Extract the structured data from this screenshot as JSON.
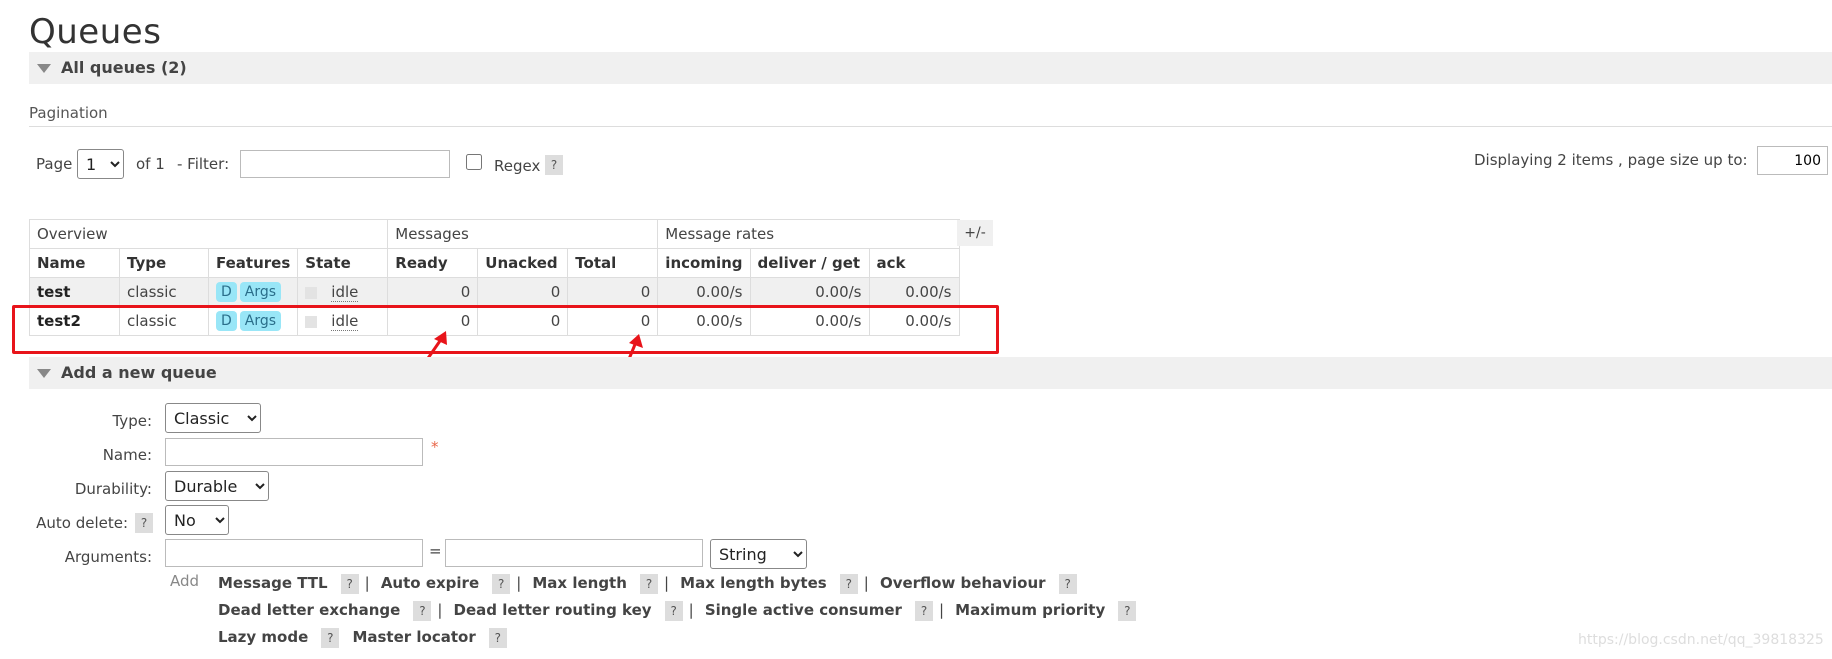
{
  "page": {
    "title": "Queues"
  },
  "all_queues": {
    "label": "All queues (2)"
  },
  "pagination": {
    "title": "Pagination",
    "page_label": "Page",
    "page_value": "1",
    "of_label": "of 1",
    "filter_label": "- Filter:",
    "filter_value": "",
    "regex_label": "Regex",
    "help": "?",
    "display_label": "Displaying 2 items , page size up to:",
    "page_size": "100"
  },
  "table": {
    "groups": [
      "Overview",
      "Messages",
      "Message rates"
    ],
    "headers": [
      "Name",
      "Type",
      "Features",
      "State",
      "Ready",
      "Unacked",
      "Total",
      "incoming",
      "deliver / get",
      "ack"
    ],
    "toggle_label": "+/-",
    "rows": [
      {
        "name": "test",
        "type": "classic",
        "features": [
          "D",
          "Args"
        ],
        "state": "idle",
        "ready": "0",
        "unacked": "0",
        "total": "0",
        "incoming": "0.00/s",
        "deliver_get": "0.00/s",
        "ack": "0.00/s"
      },
      {
        "name": "test2",
        "type": "classic",
        "features": [
          "D",
          "Args"
        ],
        "state": "idle",
        "ready": "0",
        "unacked": "0",
        "total": "0",
        "incoming": "0.00/s",
        "deliver_get": "0.00/s",
        "ack": "0.00/s"
      }
    ]
  },
  "add_queue": {
    "section_label": "Add a new queue",
    "type_label": "Type:",
    "type_value": "Classic",
    "name_label": "Name:",
    "name_value": "",
    "required_marker": "*",
    "durability_label": "Durability:",
    "durability_value": "Durable",
    "auto_delete_label": "Auto delete:",
    "auto_delete_value": "No",
    "arguments_label": "Arguments:",
    "equals": "=",
    "arg_type_value": "String",
    "add_label": "Add",
    "arg_links_row1": [
      "Message TTL",
      "Auto expire",
      "Max length",
      "Max length bytes",
      "Overflow behaviour"
    ],
    "arg_links_row2": [
      "Dead letter exchange",
      "Dead letter routing key",
      "Single active consumer",
      "Maximum priority"
    ],
    "arg_links_row3": [
      "Lazy mode",
      "Master locator"
    ]
  },
  "watermark": "https://blog.csdn.net/qq_39818325",
  "colors": {
    "badge": "#99e6f7",
    "highlight": "#e8141a",
    "section_bg": "#f0f0f0"
  }
}
